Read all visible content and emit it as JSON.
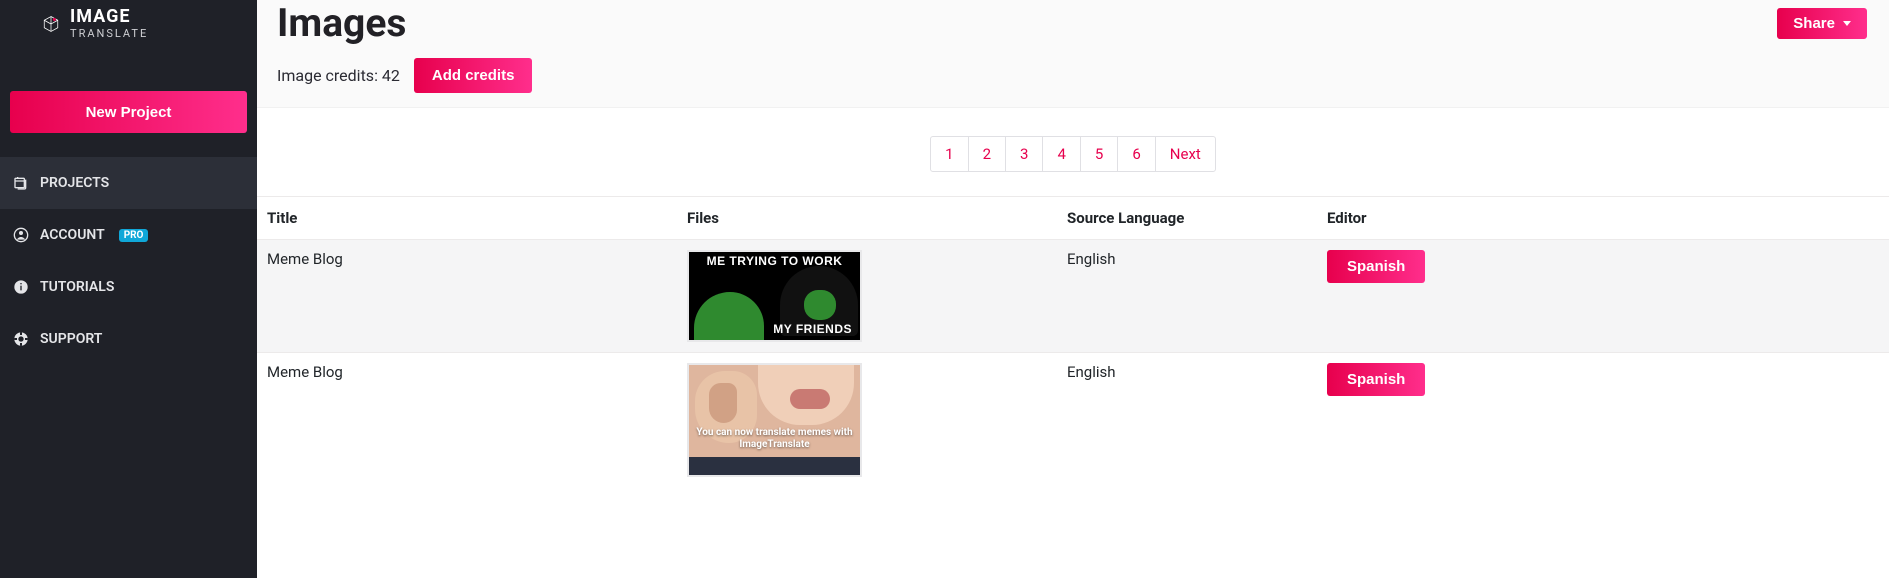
{
  "brand": {
    "word1": "IMAGE",
    "word2": "TRANSLATE"
  },
  "sidebar": {
    "new_project": "New Project",
    "items": [
      {
        "label": "PROJECTS"
      },
      {
        "label": "ACCOUNT"
      },
      {
        "label": "TUTORIALS"
      },
      {
        "label": "SUPPORT"
      }
    ],
    "pro_badge": "PRO"
  },
  "header": {
    "title": "Images",
    "credits_label": "Image credits: 42",
    "add_credits": "Add credits",
    "share": "Share"
  },
  "pagination": {
    "pages": [
      "1",
      "2",
      "3",
      "4",
      "5",
      "6"
    ],
    "next": "Next"
  },
  "table": {
    "headers": {
      "title": "Title",
      "files": "Files",
      "source_lang": "Source Language",
      "editor": "Editor"
    },
    "rows": [
      {
        "title": "Meme Blog",
        "source_lang": "English",
        "editor_label": "Spanish",
        "thumb": {
          "top": "ME TRYING TO WORK",
          "bottom": "MY FRIENDS"
        }
      },
      {
        "title": "Meme Blog",
        "source_lang": "English",
        "editor_label": "Spanish",
        "thumb": {
          "line1": "You can now translate memes with",
          "line2": "ImageTranslate"
        }
      }
    ]
  }
}
